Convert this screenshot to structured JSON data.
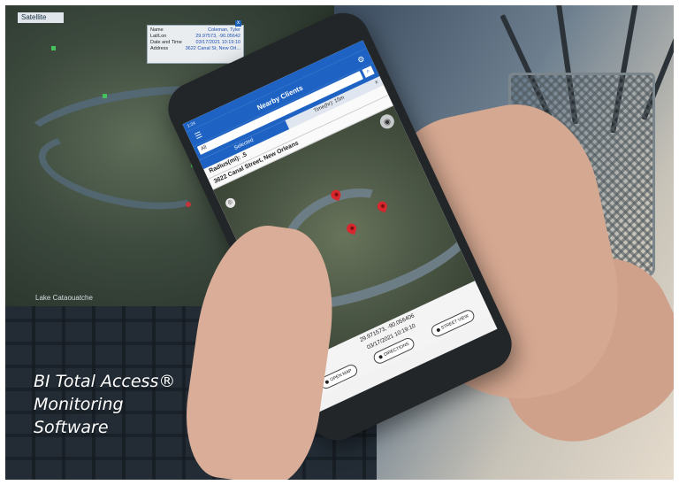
{
  "laptop": {
    "tab_label": "Satellite",
    "lake_label": "Lake Cataouatche",
    "popup": {
      "rows": [
        {
          "k": "Name",
          "v": "Coleman, Tyler"
        },
        {
          "k": "Lat/Lon",
          "v": "29.97573, -90.05642"
        },
        {
          "k": "Date and Time",
          "v": "03/17/2021 10:19:10"
        },
        {
          "k": "Address",
          "v": "3622 Canal St, New Orl..."
        }
      ],
      "close_label": "x"
    }
  },
  "phone": {
    "status": "1:24",
    "title": "Nearby Clients",
    "search_value": "All",
    "tabs": {
      "left": "Selected",
      "right": "Time(hr): 15m",
      "close": "x"
    },
    "radius": "Radius(mi): .5",
    "address": "3622 Canal Street, New Orleans",
    "coords": "29.971573, -90.056406",
    "datetime": "03/17/2021 10:19:10",
    "buttons": {
      "open_map": "OPEN MAP",
      "directions": "DIRECTIONS",
      "street_view": "STREET VIEW"
    }
  },
  "caption": {
    "line1": "BI Total Access®",
    "line2": "Monitoring",
    "line3": "Software"
  },
  "colors": {
    "app_blue": "#1e63c4",
    "pin_red": "#d8262d"
  }
}
